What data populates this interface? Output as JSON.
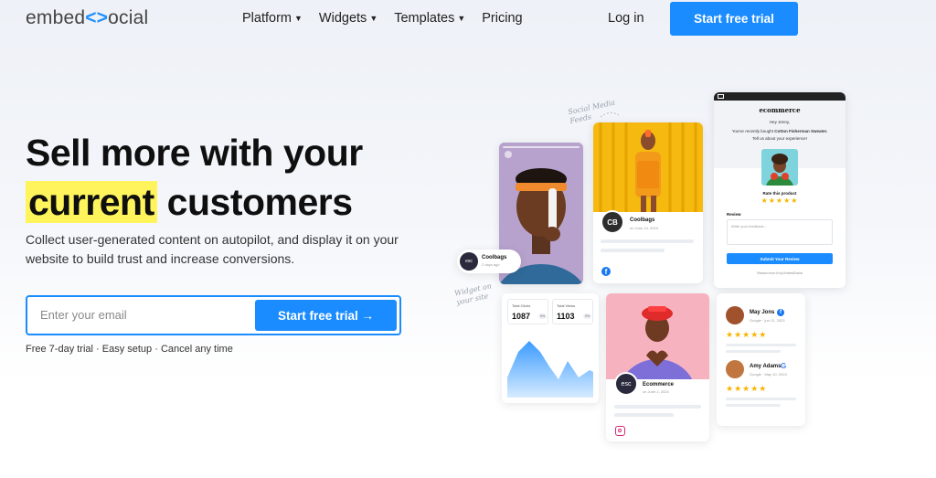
{
  "logo": {
    "part1": "embed",
    "part2": "<>",
    "part3": "ocial"
  },
  "nav": {
    "items": [
      {
        "label": "Platform",
        "has_menu": true
      },
      {
        "label": "Widgets",
        "has_menu": true
      },
      {
        "label": "Templates",
        "has_menu": true
      },
      {
        "label": "Pricing",
        "has_menu": false
      }
    ],
    "login": "Log in",
    "cta": "Start free trial"
  },
  "hero": {
    "headline_line1": "Sell more with your",
    "headline_highlight": "current",
    "headline_line2_rest": "customers",
    "subtext": "Collect user-generated content on autopilot, and display it on your website to build trust and increase conversions.",
    "email_placeholder": "Enter your email",
    "email_cta": "Start free trial →",
    "fineprint": "Free 7-day trial · Easy setup · Cancel any time"
  },
  "illustration": {
    "note_social": "Social Media Feeds",
    "note_widget": "Widget on your site",
    "badge_name": "Coolbags",
    "badge_sub": "2 days ago",
    "post_coolbags": {
      "avatar": "CB",
      "name": "Coolbags",
      "date": "on June 14, 2024"
    },
    "post_ecommerce": {
      "avatar": "esc",
      "name": "Ecommerce",
      "date": "on June 2, 2024"
    },
    "stats": {
      "clicks_label": "Total Clicks",
      "clicks_value": "1087",
      "views_label": "Total Views",
      "views_value": "1103",
      "pct": "0%"
    },
    "email": {
      "brand": "ecommerce",
      "greeting": "Hey Jenny,",
      "line1": "You've recently bought",
      "product": "Cotton Fisherman Sweater.",
      "line2": "Tell us about your experience!",
      "rate_label": "Rate this product",
      "review_label": "Review",
      "review_placeholder": "Write your feedback...",
      "submit": "Submit Your Review",
      "powered": "Review from ✉ by EmbedSocial"
    },
    "reviews": [
      {
        "name": "May Jons",
        "source": "Google",
        "date": "jun 12, 2023",
        "stars": 5
      },
      {
        "name": "Amy Adams",
        "source": "Google",
        "date": "May 10, 2023",
        "stars": 5
      }
    ],
    "colors": {
      "brand_blue": "#1a8cff",
      "highlight_yellow": "#fff45c",
      "star": "#f7b500"
    }
  }
}
